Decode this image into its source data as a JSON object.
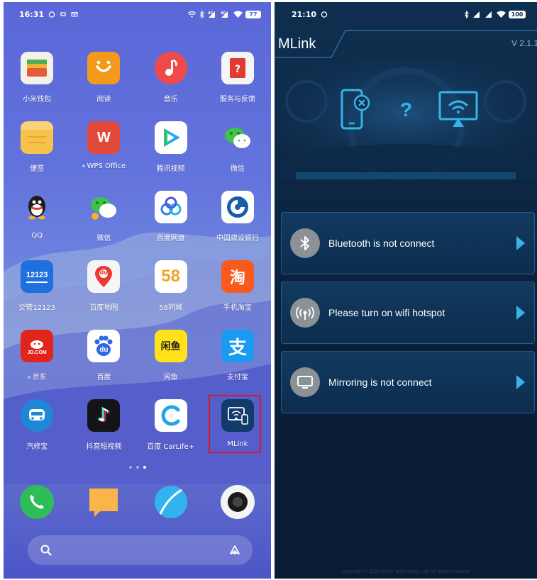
{
  "home": {
    "status": {
      "time": "16:31",
      "battery": "77"
    },
    "apps": [
      {
        "label": "小米钱包",
        "icon": "wallet-icon"
      },
      {
        "label": "阅读",
        "icon": "reader-icon"
      },
      {
        "label": "音乐",
        "icon": "music-icon"
      },
      {
        "label": "服务与反馈",
        "icon": "feedback-icon"
      },
      {
        "label": "便签",
        "icon": "notes-icon"
      },
      {
        "label": "WPS Office",
        "icon": "wps-icon",
        "glyph": "W"
      },
      {
        "label": "腾讯视频",
        "icon": "tencent-video-icon"
      },
      {
        "label": "微信",
        "icon": "wechat-icon"
      },
      {
        "label": "QQ",
        "icon": "qq-icon"
      },
      {
        "label": "微信",
        "icon": "wechat-clone-icon"
      },
      {
        "label": "百度网盘",
        "icon": "baidu-netdisk-icon"
      },
      {
        "label": "中国建设银行",
        "icon": "ccb-icon"
      },
      {
        "label": "交管12123",
        "icon": "traffic-12123-icon",
        "glyph": "12123"
      },
      {
        "label": "百度地图",
        "icon": "baidu-map-icon",
        "glyph": "du"
      },
      {
        "label": "58同城",
        "icon": "58-icon",
        "glyph": "58"
      },
      {
        "label": "手机淘宝",
        "icon": "taobao-icon",
        "glyph": "淘"
      },
      {
        "label": "京东",
        "icon": "jd-icon",
        "glyph": "JD.COM"
      },
      {
        "label": "百度",
        "icon": "baidu-icon",
        "glyph": "du"
      },
      {
        "label": "闲鱼",
        "icon": "xianyu-icon",
        "glyph": "闲鱼"
      },
      {
        "label": "支付宝",
        "icon": "alipay-icon",
        "glyph": "支"
      },
      {
        "label": "汽修宝",
        "icon": "qixiubao-icon"
      },
      {
        "label": "抖音短视频",
        "icon": "douyin-icon",
        "glyph": "♪"
      },
      {
        "label": "百度 CarLife+",
        "icon": "carlife-icon"
      },
      {
        "label": "MLink",
        "icon": "mlink-app-icon"
      }
    ],
    "dock": [
      "phone-icon",
      "messages-icon",
      "browser-icon",
      "camera-icon"
    ]
  },
  "mlink": {
    "status": {
      "time": "21:10",
      "battery": "100"
    },
    "title": "MLink",
    "version": "V 2.1.1",
    "rows": [
      {
        "label": "Bluetooth is not connect",
        "icon": "bluetooth-icon"
      },
      {
        "label": "Please turn on wifi hotspot",
        "icon": "wifi-hotspot-icon"
      },
      {
        "label": "Mirroring is not connect",
        "icon": "mirroring-icon"
      }
    ],
    "hero_question": "?",
    "footer": "Copyright © 2020 Mlink Technology Ltd. All rights reserved"
  },
  "colors": {
    "highlight": "#d4182a",
    "mlink_arrow": "#39b2ea",
    "mlink_icon_cyan": "#36b4e8"
  }
}
